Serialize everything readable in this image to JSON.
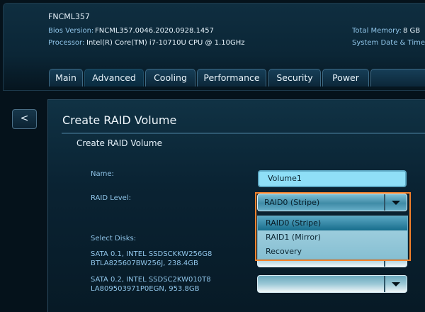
{
  "header": {
    "model": "FNCML357",
    "bios_label": "Bios Version:",
    "bios_value": "FNCML357.0046.2020.0928.1457",
    "processor_label": "Processor:",
    "processor_value": "Intel(R) Core(TM) i7-10710U CPU @ 1.10GHz",
    "memory_label": "Total Memory:",
    "memory_value": "8 GB",
    "datetime_label": "System Date & Time:"
  },
  "tabs": [
    {
      "label": "Main"
    },
    {
      "label": "Advanced",
      "active": true
    },
    {
      "label": "Cooling"
    },
    {
      "label": "Performance"
    },
    {
      "label": "Security"
    },
    {
      "label": "Power"
    }
  ],
  "back_label": "<",
  "page": {
    "title": "Create RAID Volume",
    "section": "Create RAID Volume",
    "name_label": "Name:",
    "name_value": "Volume1",
    "raid_label": "RAID Level:",
    "raid_value": "RAID0 (Stripe)",
    "raid_options": [
      "RAID0 (Stripe)",
      "RAID1 (Mirror)",
      "Recovery"
    ],
    "disks_label": "Select Disks:",
    "disks": [
      {
        "line1": "SATA 0.1, INTEL SSDSCKKW256G8",
        "line2": "BTLA825607BW256J, 238.4GB"
      },
      {
        "line1": "SATA 0.2, INTEL SSDSC2KW010T8",
        "line2": "LA809503971P0EGN, 953.8GB"
      }
    ]
  },
  "colors": {
    "highlight": "#f5822a",
    "input_bg": "#8fdff7",
    "label": "#8fc4e8"
  }
}
